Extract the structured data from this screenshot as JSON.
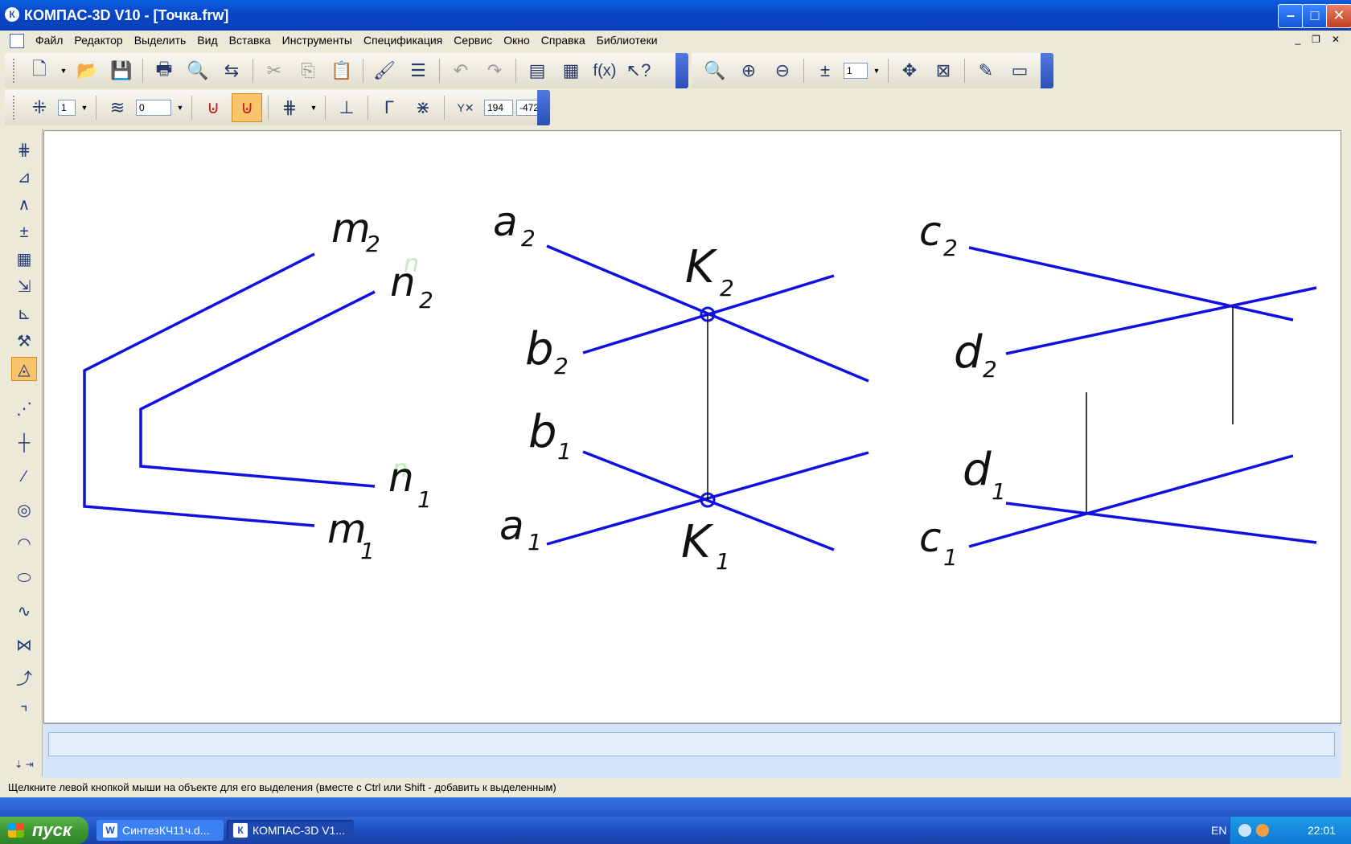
{
  "window": {
    "title": "КОМПАС-3D V10 - [Точка.frw]",
    "icon": "kompas-logo-icon",
    "buttons": [
      "minimize",
      "maximize",
      "close"
    ]
  },
  "menu": {
    "items": [
      "Файл",
      "Редактор",
      "Выделить",
      "Вид",
      "Вставка",
      "Инструменты",
      "Спецификация",
      "Сервис",
      "Окно",
      "Справка",
      "Библиотеки"
    ]
  },
  "toolbar_standard": {
    "zoom_value": "1"
  },
  "toolbar_current_state": {
    "step_value": "1",
    "layer_value": "0",
    "coord_x": "194",
    "coord_y": "-472"
  },
  "drawing": {
    "labels": {
      "m2": {
        "letter": "m",
        "sub": "2"
      },
      "n2": {
        "letter": "n",
        "sub": "2"
      },
      "n1": {
        "letter": "n",
        "sub": "1"
      },
      "m1": {
        "letter": "m",
        "sub": "1"
      },
      "a2": {
        "letter": "a",
        "sub": "2"
      },
      "k2": {
        "letter": "K",
        "sub": "2"
      },
      "b2": {
        "letter": "b",
        "sub": "2"
      },
      "b1": {
        "letter": "b",
        "sub": "1"
      },
      "a1": {
        "letter": "a",
        "sub": "1"
      },
      "k1": {
        "letter": "K",
        "sub": "1"
      },
      "c2": {
        "letter": "c",
        "sub": "2"
      },
      "d2": {
        "letter": "d",
        "sub": "2"
      },
      "d1": {
        "letter": "d",
        "sub": "1"
      },
      "c1": {
        "letter": "c",
        "sub": "1"
      }
    },
    "line_color": "#1010e0",
    "link_color": "#000000"
  },
  "status": {
    "hint": "Щелкните левой кнопкой мыши на объекте для его выделения (вместе с Ctrl или Shift - добавить к выделенным)"
  },
  "taskbar": {
    "start_label": "пуск",
    "tasks": [
      "СинтезКЧ11ч.d...",
      "КОМПАС-3D V1..."
    ],
    "language": "EN",
    "clock": "22:01"
  }
}
